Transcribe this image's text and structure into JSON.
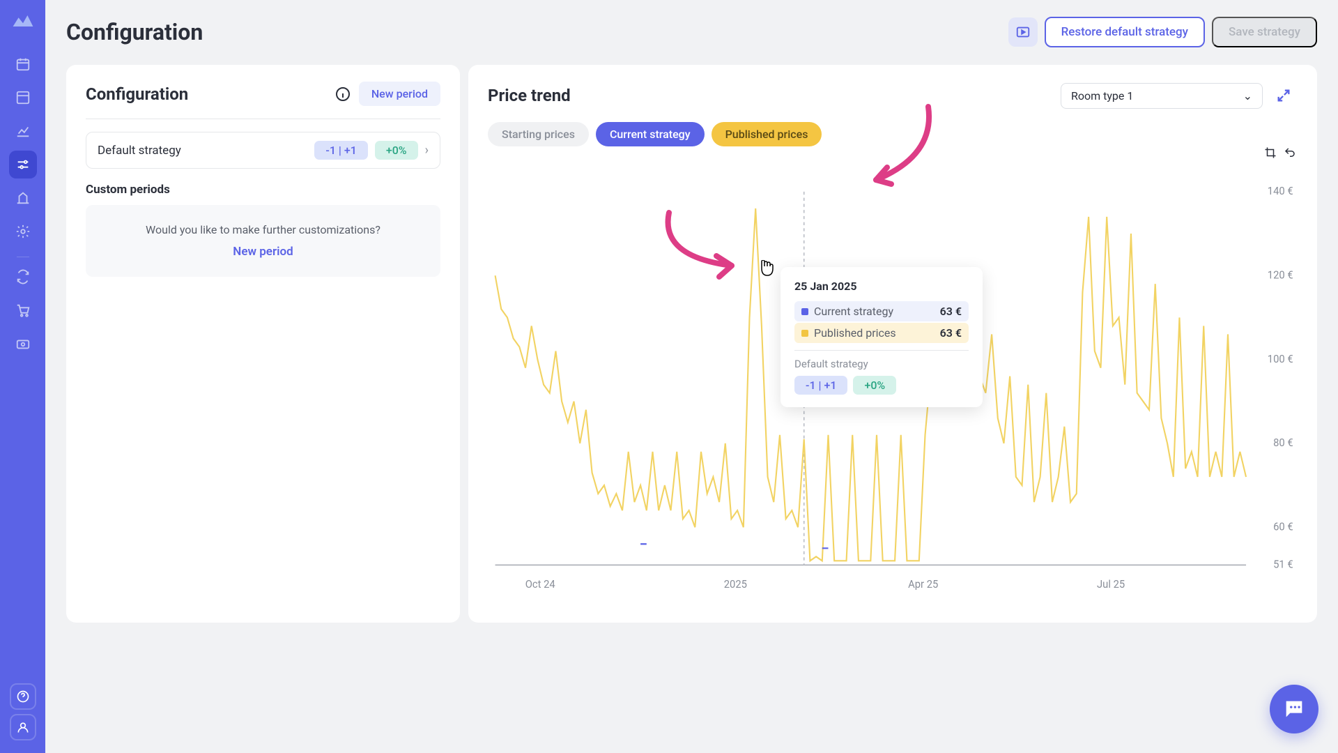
{
  "page_title": "Configuration",
  "header": {
    "restore": "Restore default strategy",
    "save": "Save strategy"
  },
  "config_panel": {
    "title": "Configuration",
    "new_period": "New period",
    "strategy_name": "Default strategy",
    "strategy_minmax": "-1 | +1",
    "strategy_pct": "+0%",
    "custom_section": "Custom periods",
    "custom_prompt": "Would you like to make further customizations?",
    "custom_new_period": "New period"
  },
  "trend_panel": {
    "title": "Price trend",
    "room_select": "Room type 1",
    "legend": {
      "starting": "Starting prices",
      "current": "Current strategy",
      "published": "Published prices"
    }
  },
  "tooltip": {
    "date": "25 Jan 2025",
    "row1_label": "Current strategy",
    "row1_value": "63 €",
    "row2_label": "Published prices",
    "row2_value": "63 €",
    "strategy_label": "Default strategy",
    "minmax": "-1 | +1",
    "pct": "+0%"
  },
  "chart_data": {
    "type": "line",
    "ylim": [
      51,
      140
    ],
    "y_ticks": [
      "140 €",
      "120 €",
      "100 €",
      "80 €",
      "60 €",
      "51 €"
    ],
    "x_ticks": [
      "Oct 24",
      "2025",
      "Apr 25",
      "Jul 25"
    ],
    "x_tick_positions_pct": [
      6,
      32,
      57,
      82
    ],
    "series": [
      {
        "name": "Published prices",
        "color": "#f2d363",
        "values": [
          120,
          112,
          110,
          105,
          103,
          98,
          108,
          100,
          94,
          92,
          102,
          90,
          85,
          90,
          80,
          88,
          73,
          68,
          70,
          65,
          68,
          64,
          78,
          66,
          70,
          64,
          78,
          64,
          70,
          64,
          78,
          62,
          64,
          60,
          78,
          68,
          72,
          66,
          80,
          62,
          64,
          60,
          110,
          136,
          108,
          72,
          66,
          82,
          62,
          64,
          60,
          81,
          52,
          53,
          52,
          82,
          52,
          52,
          52,
          82,
          52,
          52,
          52,
          82,
          52,
          52,
          52,
          82,
          52,
          52,
          52,
          82,
          98,
          100,
          96,
          114,
          100,
          96,
          92,
          114,
          96,
          92,
          106,
          86,
          80,
          96,
          72,
          70,
          94,
          66,
          72,
          92,
          66,
          72,
          84,
          66,
          68,
          116,
          134,
          102,
          98,
          134,
          108,
          110,
          94,
          130,
          92,
          90,
          88,
          118,
          86,
          80,
          72,
          110,
          74,
          78,
          72,
          108,
          72,
          78,
          72,
          106,
          72,
          78,
          72
        ]
      },
      {
        "name": "Current strategy",
        "color": "#5b63e6",
        "values": [
          null,
          null,
          null,
          null,
          null,
          null,
          null,
          null,
          null,
          null,
          null,
          null,
          null,
          null,
          null,
          null,
          null,
          null,
          null,
          null,
          null,
          null,
          null,
          null,
          56,
          56,
          null,
          null,
          null,
          null,
          null,
          null,
          null,
          null,
          null,
          null,
          null,
          null,
          null,
          null,
          null,
          null,
          null,
          null,
          null,
          null,
          null,
          null,
          null,
          null,
          null,
          null,
          null,
          null,
          55,
          55,
          null,
          null,
          null,
          null,
          null,
          null,
          null,
          null,
          null,
          null,
          null,
          null,
          null,
          null,
          null,
          null,
          null,
          null,
          null,
          null,
          null,
          null,
          null,
          null,
          null,
          null,
          null,
          null,
          null,
          null,
          null,
          null,
          null,
          null,
          null,
          null,
          null,
          null,
          null,
          null,
          null,
          null,
          null,
          null,
          null,
          null,
          null,
          null,
          null,
          null,
          null,
          null,
          null,
          null,
          null,
          null,
          null,
          null,
          null,
          null,
          null,
          null,
          null,
          null,
          null,
          null,
          null,
          null,
          null
        ]
      }
    ]
  },
  "colors": {
    "blue": "#5b63e6",
    "yellow": "#f2d363",
    "pink": "#dd3d86"
  }
}
